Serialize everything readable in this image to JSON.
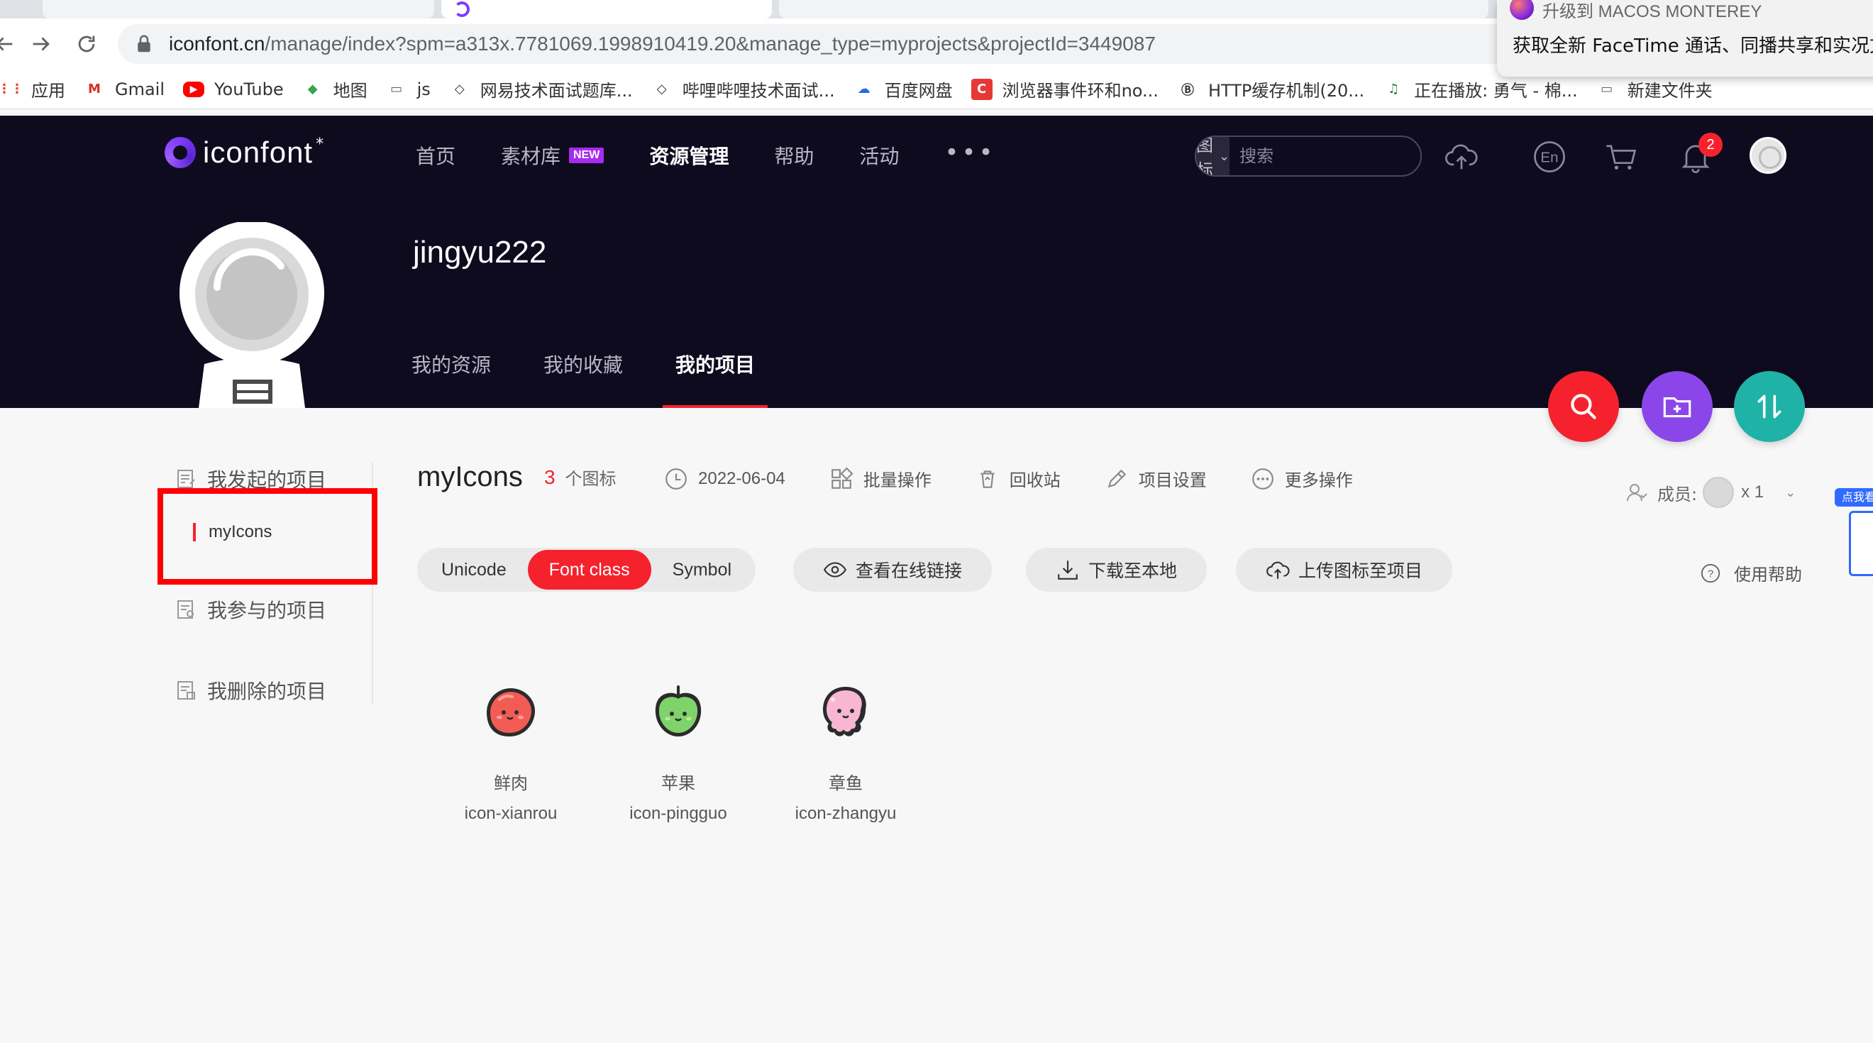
{
  "browser": {
    "url_host": "iconfont.cn",
    "url_path": "/manage/index?spm=a313x.7781069.1998910419.20&manage_type=myprojects&projectId=3449087",
    "bookmarks": [
      {
        "label": "应用",
        "icon": "apps-grid-icon",
        "color": "#e94235"
      },
      {
        "label": "Gmail",
        "icon": "gmail-icon",
        "color": "#d93025"
      },
      {
        "label": "YouTube",
        "icon": "youtube-icon",
        "color": "#ff0000"
      },
      {
        "label": "地图",
        "icon": "maps-icon",
        "color": "#34a853"
      },
      {
        "label": "js",
        "icon": "folder-icon",
        "color": "#5f6368"
      },
      {
        "label": "网易技术面试题库...",
        "icon": "netease-icon",
        "color": "#333333"
      },
      {
        "label": "哔哩哔哩技术面试...",
        "icon": "bilibili-icon",
        "color": "#333333"
      },
      {
        "label": "百度网盘",
        "icon": "baidu-pan-icon",
        "color": "#2468f2"
      },
      {
        "label": "浏览器事件环和no...",
        "icon": "c-logo-icon",
        "color": "#e53935"
      },
      {
        "label": "HTTP缓存机制(20...",
        "icon": "lb-logo-icon",
        "color": "#333333"
      },
      {
        "label": "正在播放: 勇气 - 棉...",
        "icon": "music-note-icon",
        "color": "#2e7d32"
      },
      {
        "label": "新建文件夹",
        "icon": "folder-icon",
        "color": "#5f6368"
      }
    ],
    "notification": {
      "title": "升级到 MACOS MONTEREY",
      "body": "获取全新 FaceTime 通话、同播共享和实况文"
    }
  },
  "site": {
    "logo_text": "iconfont",
    "logo_mark": "*",
    "nav": [
      {
        "label": "首页",
        "active": false
      },
      {
        "label": "素材库",
        "badge": "NEW",
        "active": false
      },
      {
        "label": "资源管理",
        "active": true
      },
      {
        "label": "帮助",
        "active": false
      },
      {
        "label": "活动",
        "active": false
      }
    ],
    "search_type": "图标",
    "search_placeholder": "搜索",
    "notification_count": "2",
    "accent": "#f5222d"
  },
  "profile": {
    "username": "jingyu222",
    "tabs": [
      {
        "label": "我的资源",
        "active": false
      },
      {
        "label": "我的收藏",
        "active": false
      },
      {
        "label": "我的项目",
        "active": true
      }
    ]
  },
  "sidebar": {
    "items": [
      {
        "label": "我发起的项目"
      },
      {
        "label": "我参与的项目"
      },
      {
        "label": "我删除的项目"
      }
    ],
    "sub_item": "myIcons"
  },
  "project": {
    "name": "myIcons",
    "count": "3",
    "count_label": "个图标",
    "date": "2022-06-04",
    "ops": {
      "batch": "批量操作",
      "recycle": "回收站",
      "settings": "项目设置",
      "more": "更多操作"
    },
    "members_label": "成员:",
    "members_count": "x 1",
    "modes": [
      {
        "label": "Unicode",
        "active": false
      },
      {
        "label": "Font class",
        "active": true
      },
      {
        "label": "Symbol",
        "active": false
      }
    ],
    "actions": {
      "view_link": "查看在线链接",
      "download": "下载至本地",
      "upload": "上传图标至项目"
    },
    "help": "使用帮助",
    "icons": [
      {
        "name": "鲜肉",
        "class": "icon-xianrou",
        "color": "#f25c54"
      },
      {
        "name": "苹果",
        "class": "icon-pingguo",
        "color": "#7fd36b"
      },
      {
        "name": "章鱼",
        "class": "icon-zhangyu",
        "color": "#f7b7d2"
      }
    ]
  },
  "right_widget": {
    "tag": "点我看"
  }
}
